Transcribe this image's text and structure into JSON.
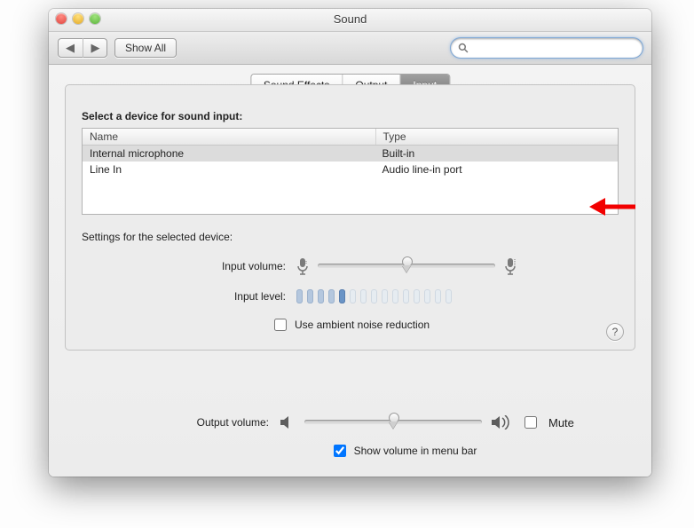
{
  "window": {
    "title": "Sound"
  },
  "toolbar": {
    "back_aria": "Back",
    "fwd_aria": "Forward",
    "showall_label": "Show All",
    "search_placeholder": ""
  },
  "tabs": [
    {
      "label": "Sound Effects",
      "active": false
    },
    {
      "label": "Output",
      "active": false
    },
    {
      "label": "Input",
      "active": true
    }
  ],
  "input": {
    "select_device_label": "Select a device for sound input:",
    "columns": {
      "name": "Name",
      "type": "Type"
    },
    "devices": [
      {
        "name": "Internal microphone",
        "type": "Built-in",
        "selected": true
      },
      {
        "name": "Line In",
        "type": "Audio line-in port",
        "selected": false
      }
    ],
    "settings_label": "Settings for the selected device:",
    "input_volume_label": "Input volume:",
    "input_volume_value": 50,
    "input_level_label": "Input level:",
    "input_level_value": 5,
    "input_level_slots": 15,
    "ambient_label": "Use ambient noise reduction",
    "ambient_checked": false
  },
  "output": {
    "output_volume_label": "Output volume:",
    "output_volume_value": 50,
    "mute_label": "Mute",
    "mute_checked": false,
    "menubar_label": "Show volume in menu bar",
    "menubar_checked": true
  },
  "help_label": "?"
}
